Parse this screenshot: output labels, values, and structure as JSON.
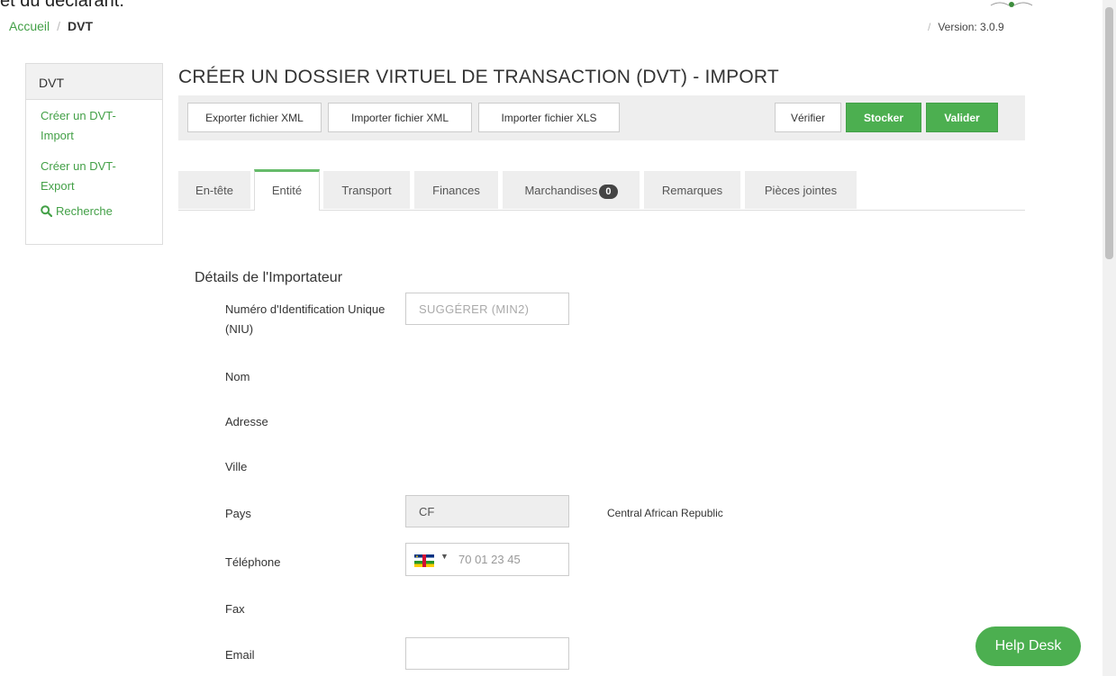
{
  "top_cut_text": "et du déclarant.",
  "breadcrumb": {
    "home": "Accueil",
    "separator": "/",
    "current": "DVT"
  },
  "version": {
    "separator": "/",
    "label": "Version: 3.0.9"
  },
  "sidebar": {
    "header": "DVT",
    "items": [
      {
        "label": "Créer un DVT-Import"
      },
      {
        "label": "Créer un DVT-Export"
      }
    ],
    "search": {
      "label": "Recherche",
      "icon": "search-icon"
    }
  },
  "page_title": "CRÉER UN DOSSIER VIRTUEL DE TRANSACTION (DVT) - IMPORT",
  "toolbar": {
    "export_xml": "Exporter fichier XML",
    "import_xml": "Importer fichier XML",
    "import_xls": "Importer fichier XLS",
    "verify": "Vérifier",
    "store": "Stocker",
    "validate": "Valider"
  },
  "tabs": [
    {
      "label": "En-tête",
      "active": false
    },
    {
      "label": "Entité",
      "active": true
    },
    {
      "label": "Transport",
      "active": false
    },
    {
      "label": "Finances",
      "active": false
    },
    {
      "label": "Marchandises",
      "active": false,
      "badge": "0"
    },
    {
      "label": "Remarques",
      "active": false
    },
    {
      "label": "Pièces jointes",
      "active": false
    }
  ],
  "importer": {
    "section_title": "Détails de l'Importateur",
    "niu_label": "Numéro d'Identification Unique (NIU)",
    "niu_placeholder": "SUGGÉRER (MIN2)",
    "nom_label": "Nom",
    "adresse_label": "Adresse",
    "ville_label": "Ville",
    "pays_label": "Pays",
    "pays_value": "CF",
    "pays_name": "Central African Republic",
    "telephone_label": "Téléphone",
    "telephone_placeholder": "70 01 23 45",
    "fax_label": "Fax",
    "email_label": "Email",
    "email_value": ""
  },
  "help_desk": "Help Desk",
  "colors": {
    "accent": "#4caf50",
    "link": "#43a047",
    "tab_inactive": "#eeeeee"
  }
}
